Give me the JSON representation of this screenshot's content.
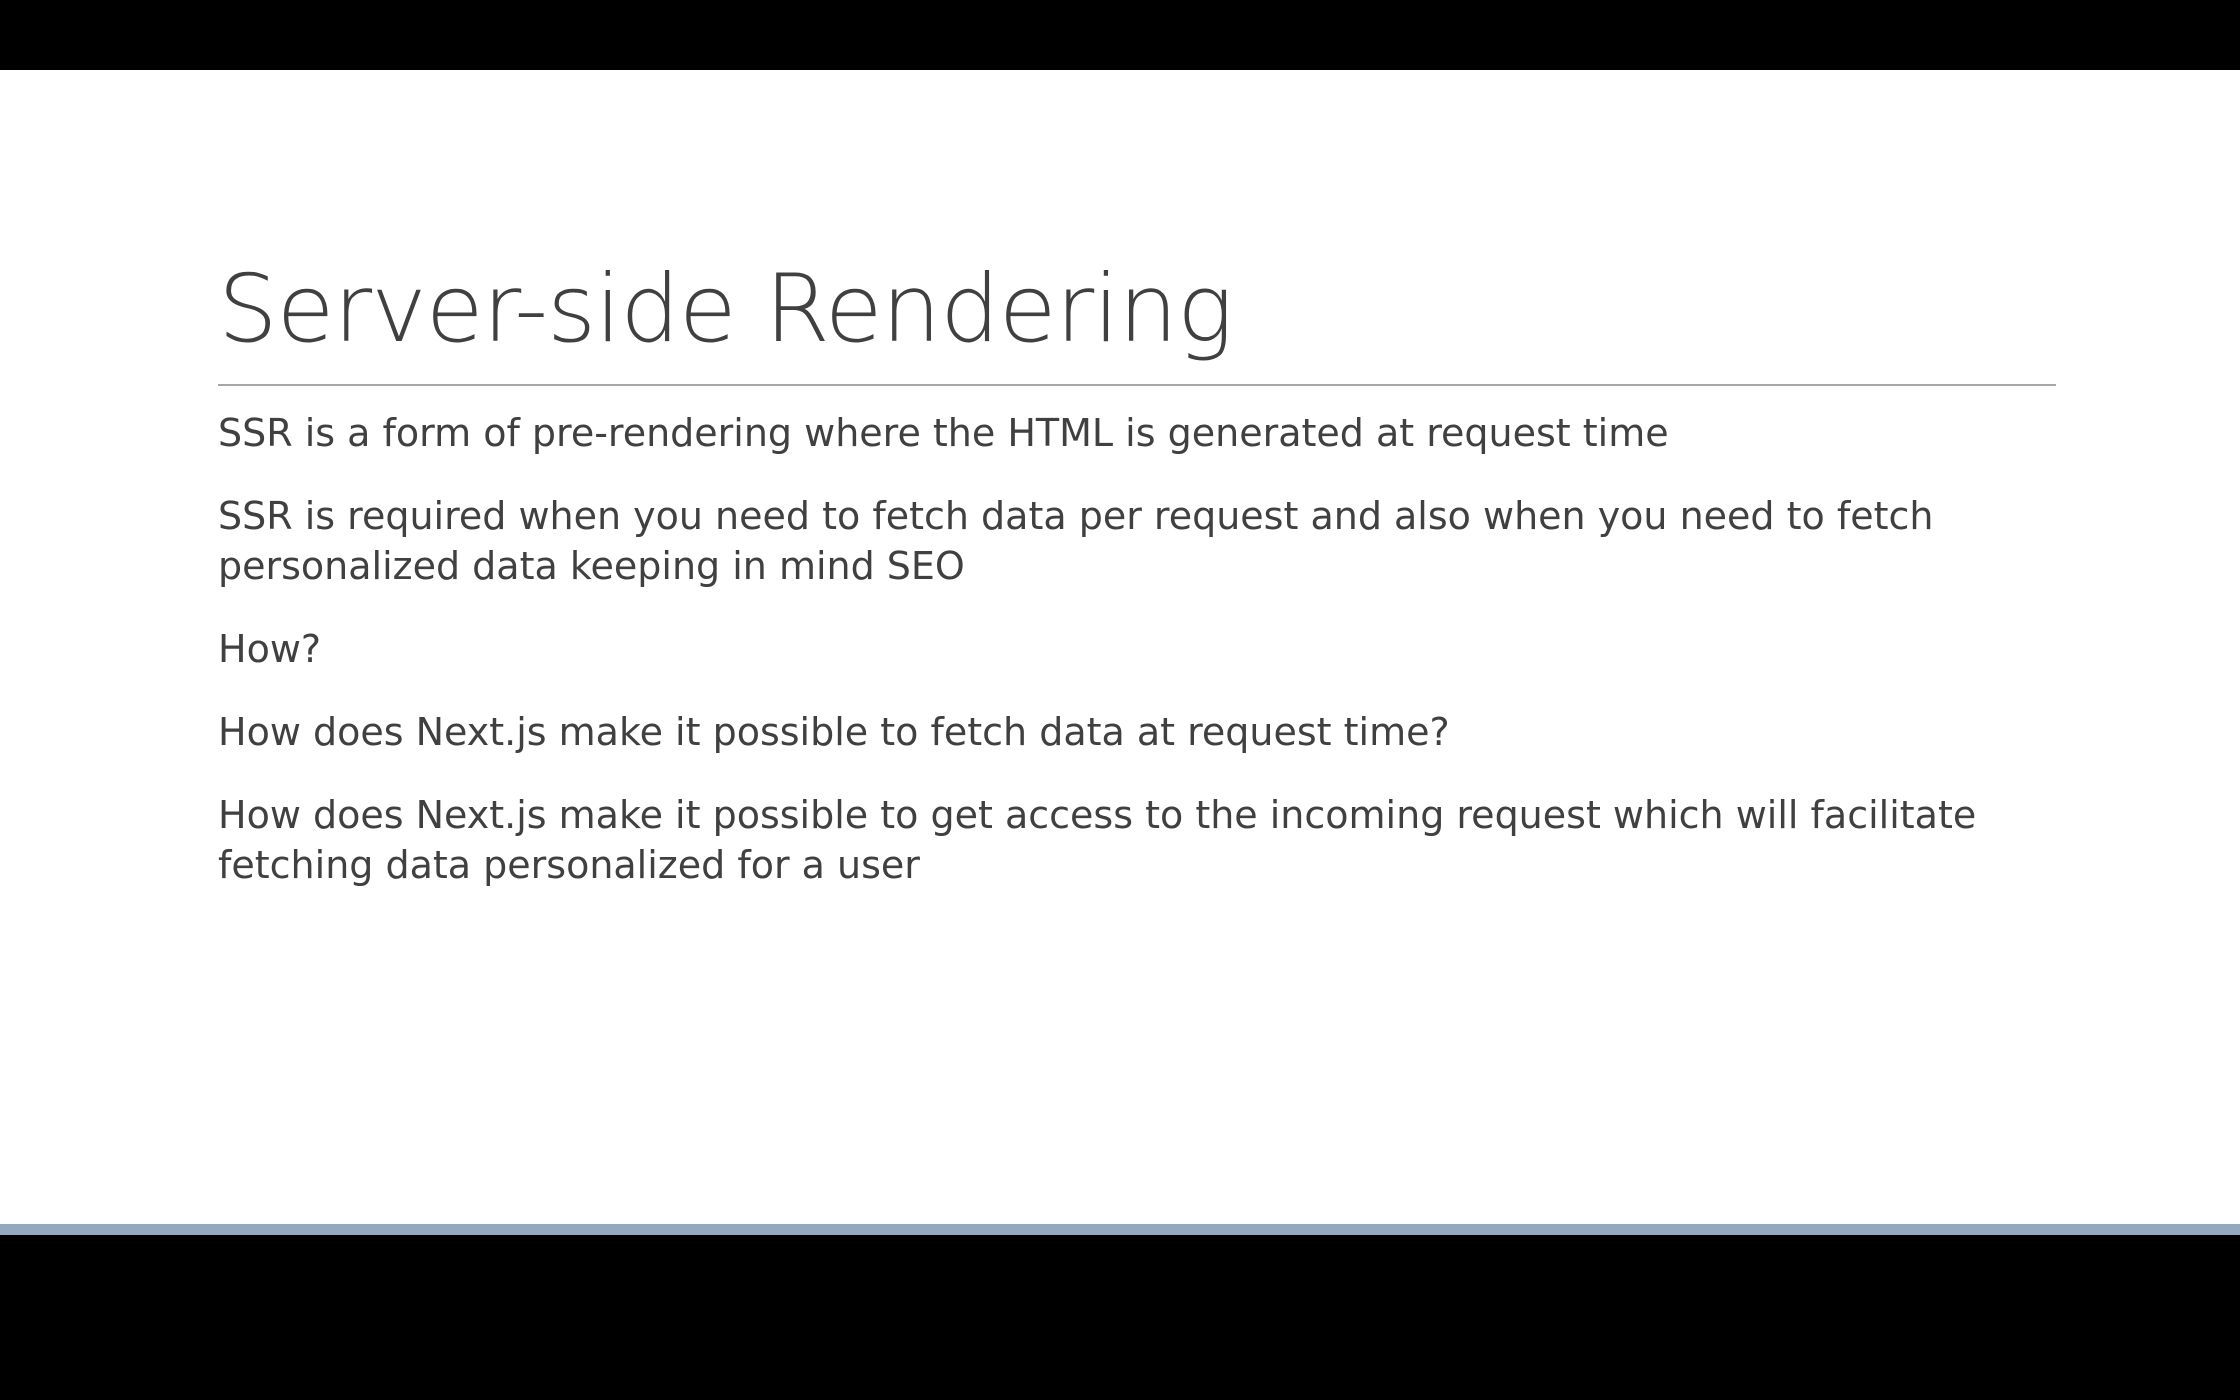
{
  "slide": {
    "title": "Server-side Rendering",
    "paragraphs": [
      "SSR is a form of pre-rendering where the HTML is generated at request time",
      "SSR is required when you need to fetch data per request and also when you need to fetch personalized data keeping in mind SEO",
      "How?",
      "How does Next.js make it possible to fetch data at request time?",
      "How does Next.js make it possible to get access to the incoming request which will facilitate fetching data personalized for a user"
    ]
  },
  "colors": {
    "background": "#000000",
    "slide_background": "#ffffff",
    "text": "#404040",
    "rule": "#a6a6a6",
    "accent_bar": "#94a9be"
  }
}
